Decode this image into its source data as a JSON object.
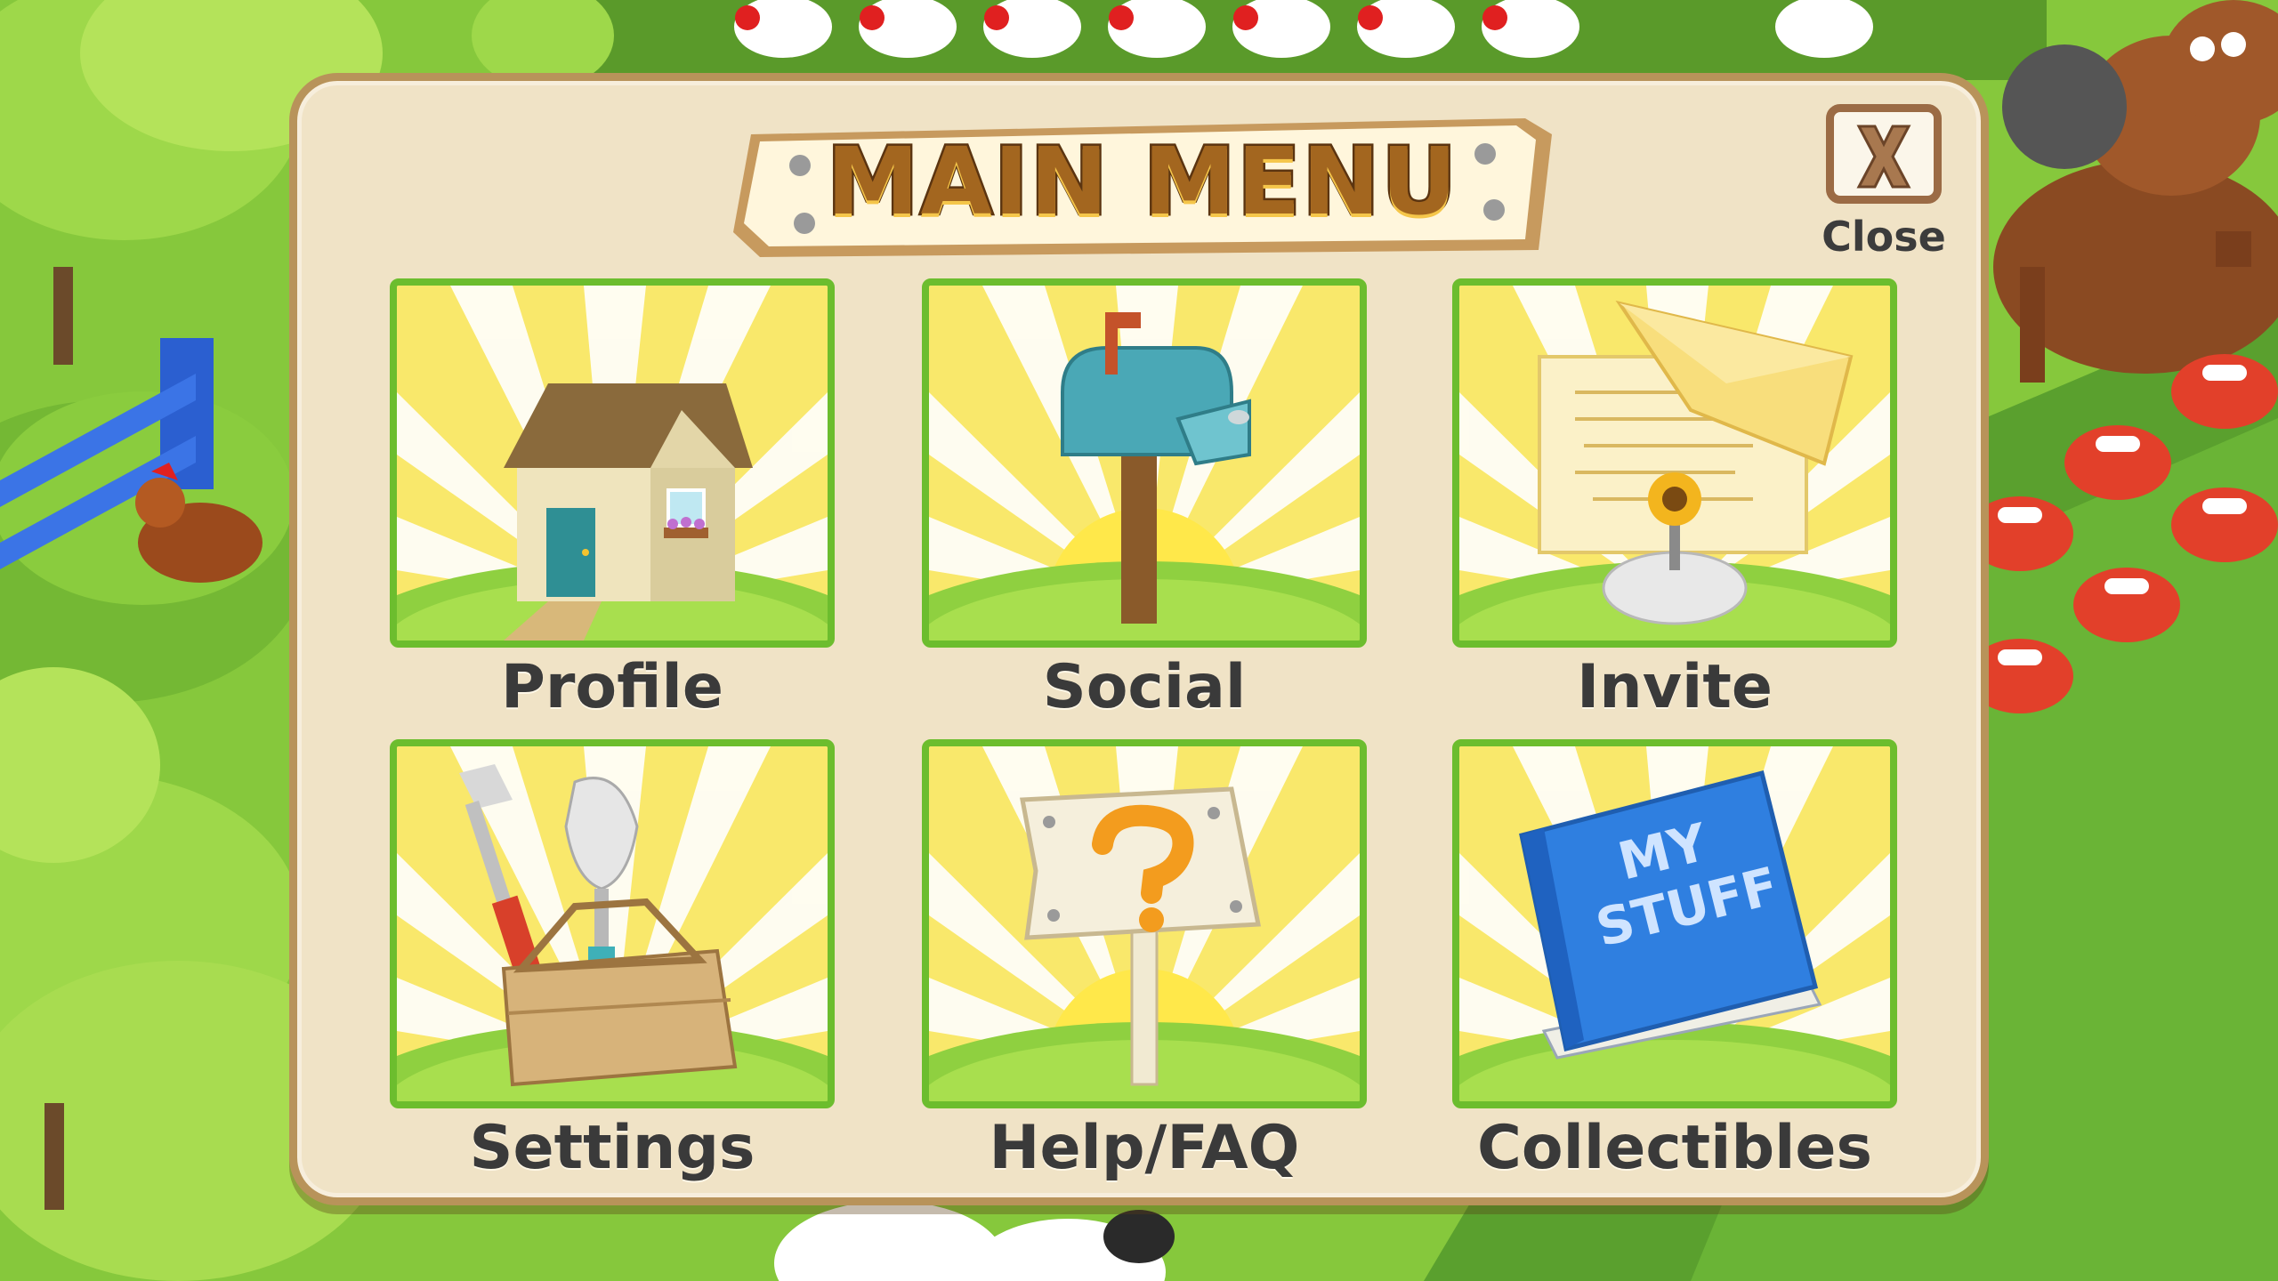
{
  "menu": {
    "title": "MAIN MENU",
    "close_label": "Close",
    "items": [
      {
        "label": "Profile",
        "icon": "house-icon"
      },
      {
        "label": "Social",
        "icon": "mailbox-icon"
      },
      {
        "label": "Invite",
        "icon": "invitation-icon"
      },
      {
        "label": "Settings",
        "icon": "toolbox-icon"
      },
      {
        "label": "Help/FAQ",
        "icon": "question-sign-icon"
      },
      {
        "label": "Collectibles",
        "icon": "book-icon"
      }
    ],
    "collectibles_book_text": [
      "MY",
      "STUFF"
    ]
  },
  "colors": {
    "panel": "#f0e3c6",
    "panel_border": "#b8935a",
    "tile_border": "#6cbd2e",
    "tile_bg": "#f9e86b",
    "title": "#a3661f"
  }
}
